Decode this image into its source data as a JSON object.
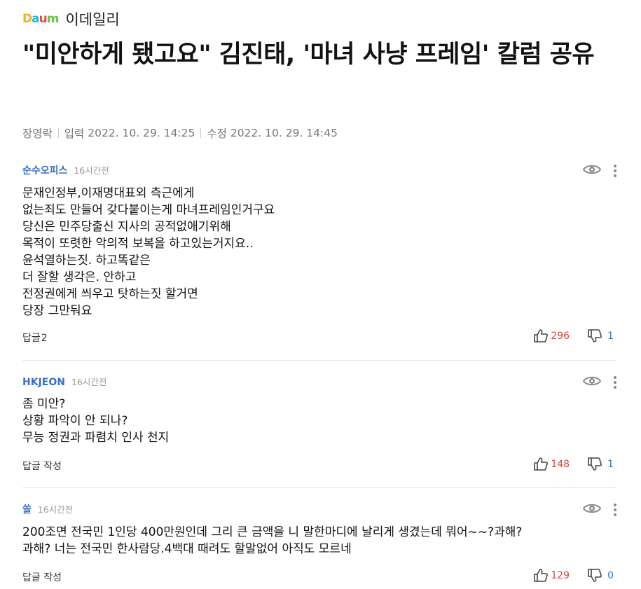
{
  "header": {
    "logo_text": "Daum",
    "press_name": "이데일리"
  },
  "article": {
    "title": "\"미안하게 됐고요\" 김진태, '마녀 사냥 프레임' 칼럼 공유",
    "reporter": "장영락",
    "input_label": "입력",
    "input_time": "2022. 10. 29. 14:25",
    "edit_label": "수정",
    "edit_time": "2022. 10. 29. 14:45"
  },
  "comments": [
    {
      "author": "순수오피스",
      "time": "16시간전",
      "body": "문재인정부,이재명대표외 측근에게\n없는죄도 만들어 갖다붙이는게 마녀프레임인거구요\n당신은 민주당출신 지사의 공적없애기위해\n목적이 또렷한 악의적 보복을 하고있는거지요..\n윤석열하는짓. 하고똑같은\n더 잘할 생각은. 안하고\n전정권에게 씌우고 탓하는짓 할거면\n당장 그만둬요",
      "reply_label": "답글",
      "reply_count": "2",
      "likes": "296",
      "dislikes": "1"
    },
    {
      "author": "HKJEON",
      "time": "16시간전",
      "body": "좀 미안?\n상황 파악이 안 되나?\n무능 정권과 파렴치 인사 천지",
      "reply_label": "답글 작성",
      "reply_count": "",
      "likes": "148",
      "dislikes": "1"
    },
    {
      "author": "쏠",
      "time": "16시간전",
      "body": "200조면 전국민 1인당 400만원인데 그리 큰 금액을 니 말한마디에 날리게 생겼는데 뭐어~~?과해?\n과해? 너는 전국민 한사람당.4백대 때려도 할말없어 아직도 모르네",
      "reply_label": "답글 작성",
      "reply_count": "",
      "likes": "129",
      "dislikes": "0"
    }
  ],
  "colors": {
    "author": "#3b6fc4",
    "like_count": "#d64545",
    "dislike_count": "#3b6fc4"
  }
}
